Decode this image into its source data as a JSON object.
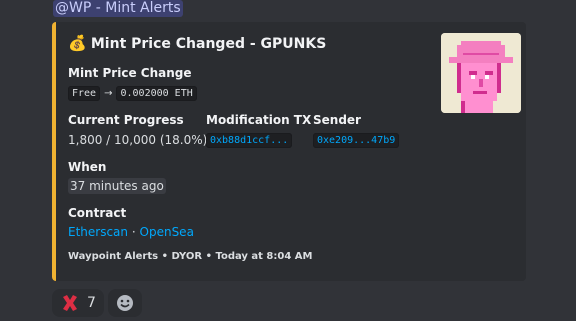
{
  "message": {
    "mention": "@WP - Mint Alerts"
  },
  "embed": {
    "title_emoji": "💰",
    "title": "Mint Price Changed - GPUNKS",
    "accent_color": "#f0b232",
    "fields": {
      "mint_price_change": {
        "name": "Mint Price Change",
        "from": "Free",
        "arrow": "→",
        "to": "0.002000 ETH"
      },
      "current_progress": {
        "name": "Current Progress",
        "value": "1,800 / 10,000 (18.0%)"
      },
      "modification_tx": {
        "name": "Modification TX",
        "value": "0xb88d1ccf..."
      },
      "sender": {
        "name": "Sender",
        "value": "0xe209...47b9"
      },
      "when": {
        "name": "When",
        "value": "37 minutes ago"
      },
      "contract": {
        "name": "Contract",
        "link1": "Etherscan",
        "separator": "·",
        "link2": "OpenSea"
      }
    },
    "footer": "Waypoint Alerts • DYOR • Today at 8:04 AM",
    "thumbnail_icon": "pink-pixel-punk-with-cowboy-hat"
  },
  "reactions": [
    {
      "icon": "cross-mark",
      "count": "7"
    },
    {
      "icon": "add-reaction-smiley"
    }
  ]
}
